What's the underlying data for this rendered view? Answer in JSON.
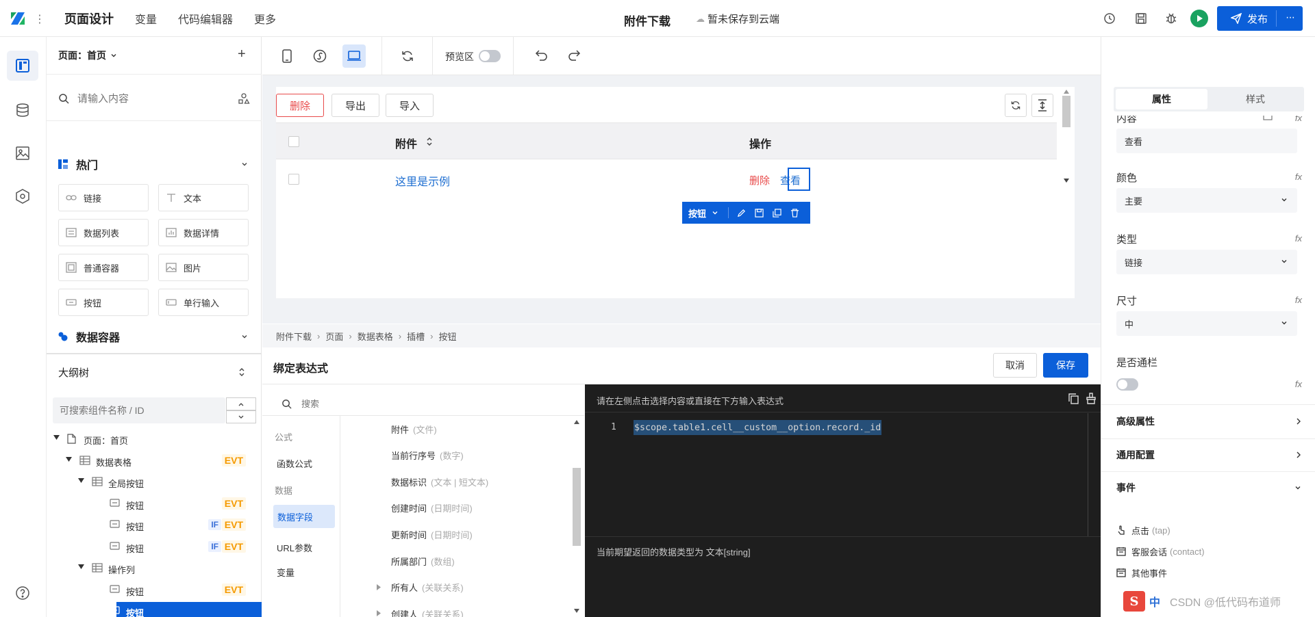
{
  "app": {
    "menu": [
      "页面设计",
      "变量",
      "代码编辑器",
      "更多"
    ],
    "page_title": "附件下载",
    "cloud_status": "暂未保存到云端",
    "publish_label": "发布"
  },
  "left_panel": {
    "page_selector": "页面：首页",
    "search_placeholder": "请输入内容",
    "hot_section": "热门",
    "components": [
      "链接",
      "文本",
      "数据列表",
      "数据详情",
      "普通容器",
      "图片",
      "按钮",
      "单行输入"
    ],
    "data_container_section": "数据容器",
    "outline_title": "大纲树",
    "outline_search_placeholder": "可搜索组件名称 / ID",
    "tree": [
      {
        "label": "页面：首页",
        "level": 0,
        "badges": []
      },
      {
        "label": "数据表格",
        "level": 1,
        "badges": [
          "EVT"
        ]
      },
      {
        "label": "全局按钮",
        "level": 2,
        "badges": []
      },
      {
        "label": "按钮",
        "level": 3,
        "badges": [
          "EVT"
        ]
      },
      {
        "label": "按钮",
        "level": 3,
        "badges": [
          "IF",
          "EVT"
        ]
      },
      {
        "label": "按钮",
        "level": 3,
        "badges": [
          "IF",
          "EVT"
        ]
      },
      {
        "label": "操作列",
        "level": 2,
        "badges": []
      },
      {
        "label": "按钮",
        "level": 3,
        "badges": [
          "EVT"
        ]
      },
      {
        "label": "按钮",
        "level": 3,
        "badges": [],
        "selected": true
      }
    ]
  },
  "toolbar": {
    "preview_label": "预览区"
  },
  "canvas": {
    "buttons": [
      "删除",
      "导出",
      "导入"
    ],
    "table_headers": [
      "附件",
      "操作"
    ],
    "row_link": "这里是示例",
    "row_actions": [
      "删除",
      "查看"
    ],
    "selection_label": "按钮"
  },
  "breadcrumb": [
    "附件下载",
    "页面",
    "数据表格",
    "插槽",
    "按钮"
  ],
  "bind_dialog": {
    "title": "绑定表达式",
    "cancel": "取消",
    "save": "保存",
    "search_placeholder": "搜索",
    "categories": [
      {
        "label": "公式",
        "type": "header"
      },
      {
        "label": "函数公式",
        "type": "item"
      },
      {
        "label": "数据",
        "type": "header"
      },
      {
        "label": "数据字段",
        "type": "item",
        "active": true
      },
      {
        "label": "URL参数",
        "type": "item"
      },
      {
        "label": "变量",
        "type": "item"
      }
    ],
    "fields": [
      {
        "name": "附件",
        "type": "(文件)",
        "expandable": false
      },
      {
        "name": "当前行序号",
        "type": "(数字)",
        "expandable": false
      },
      {
        "name": "数据标识",
        "type": "(文本 | 短文本)",
        "expandable": false
      },
      {
        "name": "创建时间",
        "type": "(日期时间)",
        "expandable": false
      },
      {
        "name": "更新时间",
        "type": "(日期时间)",
        "expandable": false
      },
      {
        "name": "所属部门",
        "type": "(数组)",
        "expandable": false
      },
      {
        "name": "所有人",
        "type": "(关联关系)",
        "expandable": true
      },
      {
        "name": "创建人",
        "type": "(关联关系)",
        "expandable": true
      }
    ],
    "editor_hint": "请在左侧点击选择内容或直接在下方输入表达式",
    "line_number": "1",
    "expression": "$scope.table1.cell__custom__option.record._id",
    "return_type_hint": "当前期望返回的数据类型为 文本[string]"
  },
  "right_panel": {
    "tabs": [
      "属性",
      "样式"
    ],
    "content_label": "内容",
    "content_value": "查看",
    "color_label": "颜色",
    "color_value": "主要",
    "type_label": "类型",
    "type_value": "链接",
    "size_label": "尺寸",
    "size_value": "中",
    "block_label": "是否通栏",
    "advanced": "高级属性",
    "general": "通用配置",
    "events": "事件",
    "event_items": [
      {
        "name": "点击",
        "code": "(tap)"
      },
      {
        "name": "客服会话",
        "code": "(contact)"
      },
      {
        "name": "其他事件",
        "code": ""
      }
    ],
    "fx": "fx"
  },
  "watermark": {
    "ime": "中",
    "text": "CSDN @低代码布道师"
  },
  "colors": {
    "primary": "#0b5fd9",
    "danger": "#e84a4a",
    "link": "#1f6fd1",
    "evt": "#f59a00",
    "dark_panel": "#1e1e1e"
  }
}
